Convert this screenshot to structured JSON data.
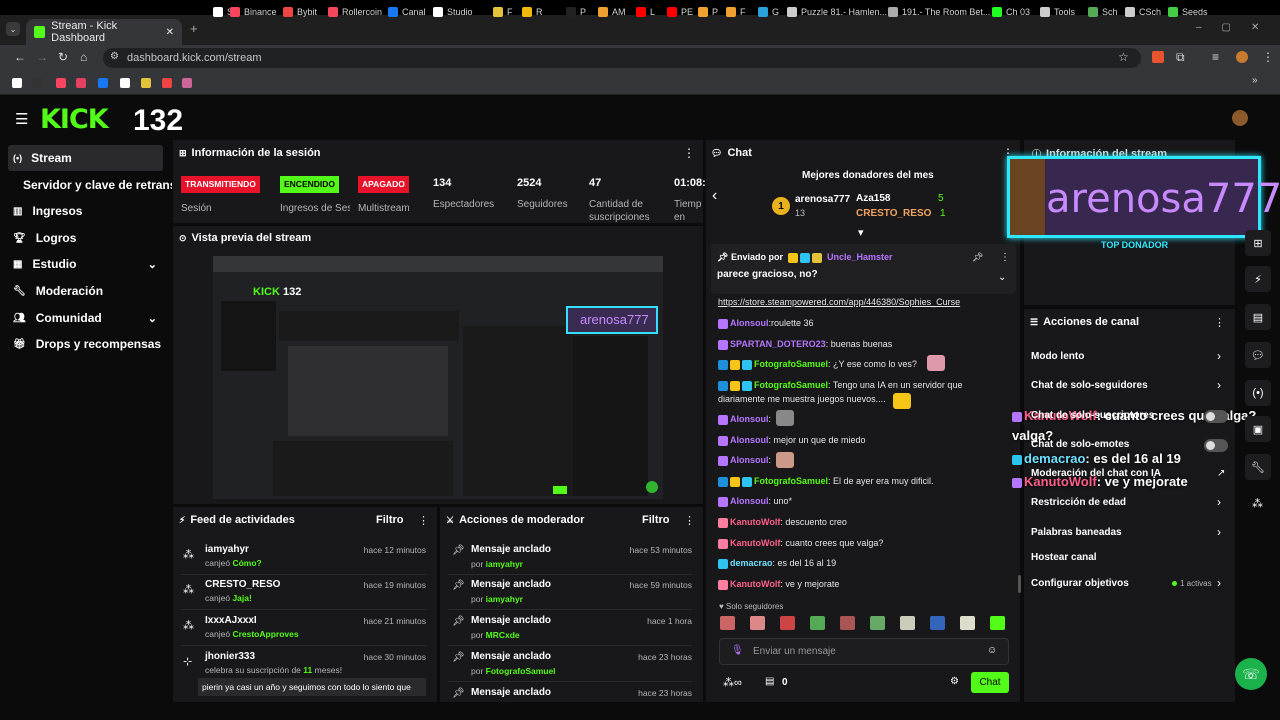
{
  "browser": {
    "tab_title": "Stream - Kick Dashboard",
    "url": "dashboard.kick.com/stream",
    "bookmarks": [
      "S",
      "Binance",
      "Bybit",
      "Rollercoin",
      "Canal",
      "Studio",
      "F",
      "R",
      "P",
      "AM",
      "L",
      "PE",
      "P",
      "F",
      "G",
      "Puzzle 81.- Hamlen...",
      "191.- The Room Bet...",
      "Ch 03",
      "Tools",
      "Sch",
      "CSch",
      "Seeds"
    ]
  },
  "header": {
    "logo": "KICK",
    "logo_number": "132"
  },
  "sidebar": {
    "items": [
      {
        "label": "Stream"
      },
      {
        "label": "Servidor y clave de retransmisión"
      },
      {
        "label": "Ingresos"
      },
      {
        "label": "Logros"
      },
      {
        "label": "Estudio"
      },
      {
        "label": "Moderación"
      },
      {
        "label": "Comunidad"
      },
      {
        "label": "Drops y recompensas"
      }
    ]
  },
  "session": {
    "title": "Información de la sesión",
    "statuses": [
      {
        "tag": "TRANSMITIENDO",
        "label": "Sesión",
        "color": "#e8132b"
      },
      {
        "tag": "ENCENDIDO",
        "label": "Ingresos de Sesión",
        "color": "#53fc18"
      },
      {
        "tag": "APAGADO",
        "label": "Multistream",
        "color": "#e8132b"
      }
    ],
    "stats": [
      {
        "value": "134",
        "label": "Espectadores"
      },
      {
        "value": "2524",
        "label": "Seguidores"
      },
      {
        "value": "47",
        "label": "Cantidad de suscripciones"
      },
      {
        "value": "01:08:",
        "label": "Tiempo en vivo"
      }
    ]
  },
  "preview": {
    "title": "Vista previa del stream",
    "overlay_name": "arenosa777",
    "logo_number": "132"
  },
  "feed": {
    "title": "Feed de actividades",
    "filter": "Filtro",
    "items": [
      {
        "user": "iamyahyr",
        "time": "hace 12 minutos",
        "action": "canjeó",
        "reward": "Cómo?"
      },
      {
        "user": "CRESTO_RESO",
        "time": "hace 19 minutos",
        "action": "canjeó",
        "reward": "Jaja!"
      },
      {
        "user": "IxxxAJxxxI",
        "time": "hace 21 minutos",
        "action": "canjeó",
        "reward": "CrestoApproves"
      },
      {
        "user": "jhonier333",
        "time": "hace 30 minutos",
        "action": "celebra su suscripción de",
        "months": "11",
        "suffix": "meses!",
        "message": "pierin ya casi un año y seguimos con todo lo siento que"
      }
    ]
  },
  "modactions": {
    "title": "Acciones de moderador",
    "filter": "Filtro",
    "items": [
      {
        "action": "Mensaje anclado",
        "by": "iamyahyr",
        "time": "hace 53 minutos"
      },
      {
        "action": "Mensaje anclado",
        "by": "iamyahyr",
        "time": "hace 59 minutos"
      },
      {
        "action": "Mensaje anclado",
        "by": "MRCxde",
        "time": "hace 1 hora"
      },
      {
        "action": "Mensaje anclado",
        "by": "FotografoSamuel",
        "time": "hace 23 horas"
      },
      {
        "action": "Mensaje anclado",
        "by": "",
        "time": "hace 23 horas"
      }
    ]
  },
  "chat": {
    "title": "Chat",
    "donors_title": "Mejores donadores del mes",
    "donors": [
      {
        "rank": "1",
        "name": "arenosa777",
        "amount": "13"
      },
      {
        "name": "Aza158",
        "amount": "5"
      },
      {
        "name": "CRESTO_RESO",
        "amount": "1"
      }
    ],
    "pinned": {
      "label": "Enviado por",
      "user": "Uncle_Hamster",
      "text": "parece gracioso, no?"
    },
    "messages": [
      {
        "user": "",
        "text": "https://store.steampowered.com/app/446380/Sophies_Curse",
        "color": "#ffffff"
      },
      {
        "user": "Alonsoul",
        "text": ":roulette 36",
        "color": "#b675ff"
      },
      {
        "user": "SPARTAN_DOTERO23",
        "text": ": buenas buenas",
        "color": "#b675ff"
      },
      {
        "user": "FotografoSamuel",
        "text": ": ¿Y ese como lo ves?",
        "color": "#53fc18"
      },
      {
        "user": "FotografoSamuel",
        "text": ": Tengo una IA en un servidor que",
        "color": "#53fc18"
      },
      {
        "user": "",
        "text": "diariamente me muestra juegos nuevos....",
        "color": "#ffffff"
      },
      {
        "user": "Alonsoul",
        "text": ":",
        "color": "#b675ff"
      },
      {
        "user": "Alonsoul",
        "text": ": mejor un que de miedo",
        "color": "#b675ff"
      },
      {
        "user": "Alonsoul",
        "text": ":",
        "color": "#b675ff"
      },
      {
        "user": "FotografoSamuel",
        "text": ": El de ayer era muy dificil.",
        "color": "#53fc18"
      },
      {
        "user": "Alonsoul",
        "text": ": uno*",
        "color": "#b675ff"
      },
      {
        "user": "KanutoWolf",
        "text": ": descuento creo",
        "color": "#ff5f8a"
      },
      {
        "user": "KanutoWolf",
        "text": ": cuanto crees que valga?",
        "color": "#ff5f8a"
      },
      {
        "user": "demacrao",
        "text": ": es del 16 al 19",
        "color": "#6ee0ff"
      },
      {
        "user": "KanutoWolf",
        "text": ": ve y mejorate",
        "color": "#ff5f8a"
      }
    ],
    "followers_only": "Solo seguidores",
    "input_placeholder": "Enviar un mensaje",
    "points": "0",
    "send_label": "Chat"
  },
  "stream_info": {
    "title": "Información del stream"
  },
  "overlay": {
    "name": "arenosa777",
    "label": "TOP DONADOR"
  },
  "float_chat": [
    {
      "user": "KanutoWolf",
      "text": ": cuanto crees que valga?"
    },
    {
      "user": "demacrao",
      "text": ": es del 16 al 19"
    },
    {
      "user": "KanutoWolf",
      "text": ": ve y mejorate"
    }
  ],
  "channel_actions": {
    "title": "Acciones de canal",
    "items": [
      {
        "label": "Modo lento",
        "control": "chevron"
      },
      {
        "label": "Chat de solo-seguidores",
        "control": "chevron"
      },
      {
        "label": "Chat de solo-suscriptores",
        "control": "toggle"
      },
      {
        "label": "Chat de solo-emotes",
        "control": "toggle"
      },
      {
        "label": "Moderación del chat con IA",
        "control": "external"
      },
      {
        "label": "Restricción de edad",
        "control": "chevron"
      },
      {
        "label": "Palabras baneadas",
        "control": "chevron"
      },
      {
        "label": "Hostear canal",
        "control": "none"
      },
      {
        "label": "Configurar objetivos",
        "control": "chevron",
        "extra": "1 activas"
      }
    ]
  }
}
